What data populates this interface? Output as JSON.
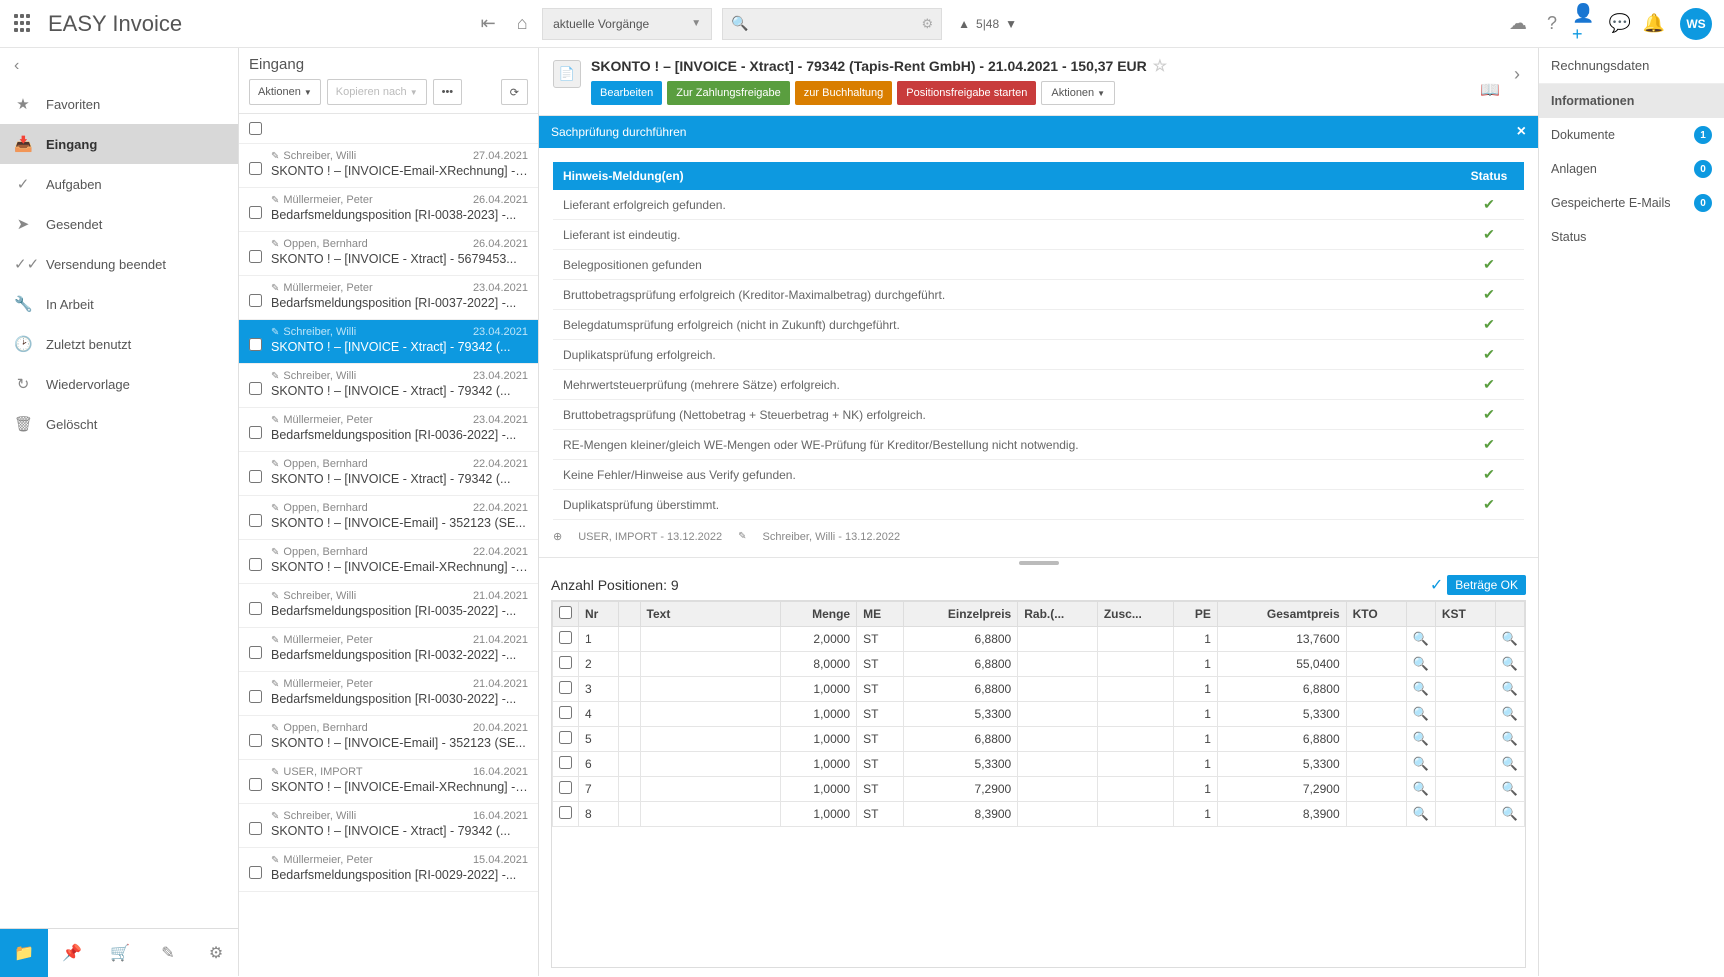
{
  "header": {
    "title": "EASY Invoice",
    "filter": "aktuelle Vorgänge",
    "pager": "5|48",
    "avatar": "WS"
  },
  "sidebar": {
    "items": [
      {
        "icon": "★",
        "label": "Favoriten"
      },
      {
        "icon": "📥",
        "label": "Eingang",
        "active": true
      },
      {
        "icon": "✓",
        "label": "Aufgaben"
      },
      {
        "icon": "➤",
        "label": "Gesendet"
      },
      {
        "icon": "✓✓",
        "label": "Versendung beendet"
      },
      {
        "icon": "🔧",
        "label": "In Arbeit"
      },
      {
        "icon": "🕑",
        "label": "Zuletzt benutzt"
      },
      {
        "icon": "↻",
        "label": "Wiedervorlage"
      },
      {
        "icon": "🗑",
        "label": "Gelöscht"
      }
    ]
  },
  "inbox": {
    "title": "Eingang",
    "actions_label": "Aktionen",
    "copy_label": "Kopieren nach",
    "items": [
      {
        "author": "Schreiber, Willi",
        "date": "27.04.2021",
        "subject": "SKONTO ! – [INVOICE-Email-XRechnung] - ..."
      },
      {
        "author": "Müllermeier, Peter",
        "date": "26.04.2021",
        "subject": "Bedarfsmeldungsposition [RI-0038-2023] -..."
      },
      {
        "author": "Oppen, Bernhard",
        "date": "26.04.2021",
        "subject": "SKONTO ! – [INVOICE - Xtract] - 5679453..."
      },
      {
        "author": "Müllermeier, Peter",
        "date": "23.04.2021",
        "subject": "Bedarfsmeldungsposition [RI-0037-2022] -..."
      },
      {
        "author": "Schreiber, Willi",
        "date": "23.04.2021",
        "subject": "SKONTO ! – [INVOICE - Xtract] - 79342 (...",
        "selected": true
      },
      {
        "author": "Schreiber, Willi",
        "date": "23.04.2021",
        "subject": "SKONTO ! – [INVOICE - Xtract] - 79342 (..."
      },
      {
        "author": "Müllermeier, Peter",
        "date": "23.04.2021",
        "subject": "Bedarfsmeldungsposition [RI-0036-2022] -..."
      },
      {
        "author": "Oppen, Bernhard",
        "date": "22.04.2021",
        "subject": "SKONTO ! – [INVOICE - Xtract] - 79342 (..."
      },
      {
        "author": "Oppen, Bernhard",
        "date": "22.04.2021",
        "subject": "SKONTO ! – [INVOICE-Email] - 352123 (SE..."
      },
      {
        "author": "Oppen, Bernhard",
        "date": "22.04.2021",
        "subject": "SKONTO ! – [INVOICE-Email-XRechnung] - ..."
      },
      {
        "author": "Schreiber, Willi",
        "date": "21.04.2021",
        "subject": "Bedarfsmeldungsposition [RI-0035-2022] -..."
      },
      {
        "author": "Müllermeier, Peter",
        "date": "21.04.2021",
        "subject": "Bedarfsmeldungsposition [RI-0032-2022] -..."
      },
      {
        "author": "Müllermeier, Peter",
        "date": "21.04.2021",
        "subject": "Bedarfsmeldungsposition [RI-0030-2022] -..."
      },
      {
        "author": "Oppen, Bernhard",
        "date": "20.04.2021",
        "subject": "SKONTO ! – [INVOICE-Email] - 352123 (SE..."
      },
      {
        "author": "USER, IMPORT",
        "date": "16.04.2021",
        "subject": "SKONTO ! – [INVOICE-Email-XRechnung] - ..."
      },
      {
        "author": "Schreiber, Willi",
        "date": "16.04.2021",
        "subject": "SKONTO ! – [INVOICE - Xtract] - 79342 (..."
      },
      {
        "author": "Müllermeier, Peter",
        "date": "15.04.2021",
        "subject": "Bedarfsmeldungsposition [RI-0029-2022] -..."
      }
    ]
  },
  "detail": {
    "title": "SKONTO ! – [INVOICE - Xtract] - 79342 (Tapis-Rent GmbH) - 21.04.2021 - 150,37 EUR",
    "buttons": {
      "edit": "Bearbeiten",
      "release": "Zur Zahlungsfreigabe",
      "accounting": "zur Buchhaltung",
      "pos_release": "Positionsfreigabe starten",
      "actions": "Aktionen"
    },
    "panel_title": "Sachprüfung durchführen",
    "msg_header": {
      "msg": "Hinweis-Meldung(en)",
      "status": "Status"
    },
    "messages": [
      "Lieferant erfolgreich gefunden.",
      "Lieferant ist eindeutig.",
      "Belegpositionen gefunden",
      "Bruttobetragsprüfung erfolgreich (Kreditor-Maximalbetrag) durchgeführt.",
      "Belegdatumsprüfung erfolgreich (nicht in Zukunft) durchgeführt.",
      "Duplikatsprüfung erfolgreich.",
      "Mehrwertsteuerprüfung (mehrere Sätze) erfolgreich.",
      "Bruttobetragsprüfung (Nettobetrag + Steuerbetrag + NK) erfolgreich.",
      "RE-Mengen kleiner/gleich WE-Mengen oder WE-Prüfung für Kreditor/Bestellung nicht notwendig.",
      "Keine Fehler/Hinweise aus Verify gefunden.",
      "Duplikatsprüfung überstimmt."
    ],
    "audit": {
      "created": "USER, IMPORT - 13.12.2022",
      "modified": "Schreiber, Willi - 13.12.2022"
    }
  },
  "positions": {
    "title": "Anzahl Positionen: 9",
    "ok_label": "Beträge OK",
    "headers": {
      "nr": "Nr",
      "text": "Text",
      "menge": "Menge",
      "me": "ME",
      "ep": "Einzelpreis",
      "rab": "Rab.(...",
      "zusc": "Zusc...",
      "pe": "PE",
      "gp": "Gesamtpreis",
      "kto": "KTO",
      "kst": "KST"
    },
    "rows": [
      {
        "nr": "1",
        "menge": "2,0000",
        "me": "ST",
        "ep": "6,8800",
        "pe": "1",
        "gp": "13,7600"
      },
      {
        "nr": "2",
        "menge": "8,0000",
        "me": "ST",
        "ep": "6,8800",
        "pe": "1",
        "gp": "55,0400"
      },
      {
        "nr": "3",
        "menge": "1,0000",
        "me": "ST",
        "ep": "6,8800",
        "pe": "1",
        "gp": "6,8800"
      },
      {
        "nr": "4",
        "menge": "1,0000",
        "me": "ST",
        "ep": "5,3300",
        "pe": "1",
        "gp": "5,3300"
      },
      {
        "nr": "5",
        "menge": "1,0000",
        "me": "ST",
        "ep": "6,8800",
        "pe": "1",
        "gp": "6,8800"
      },
      {
        "nr": "6",
        "menge": "1,0000",
        "me": "ST",
        "ep": "5,3300",
        "pe": "1",
        "gp": "5,3300"
      },
      {
        "nr": "7",
        "menge": "1,0000",
        "me": "ST",
        "ep": "7,2900",
        "pe": "1",
        "gp": "7,2900"
      },
      {
        "nr": "8",
        "menge": "1,0000",
        "me": "ST",
        "ep": "8,3900",
        "pe": "1",
        "gp": "8,3900"
      }
    ]
  },
  "rpanel": {
    "title": "Rechnungsdaten",
    "items": [
      {
        "label": "Informationen",
        "active": true
      },
      {
        "label": "Dokumente",
        "badge": "1"
      },
      {
        "label": "Anlagen",
        "badge": "0"
      },
      {
        "label": "Gespeicherte E-Mails",
        "badge": "0"
      },
      {
        "label": "Status"
      }
    ]
  }
}
